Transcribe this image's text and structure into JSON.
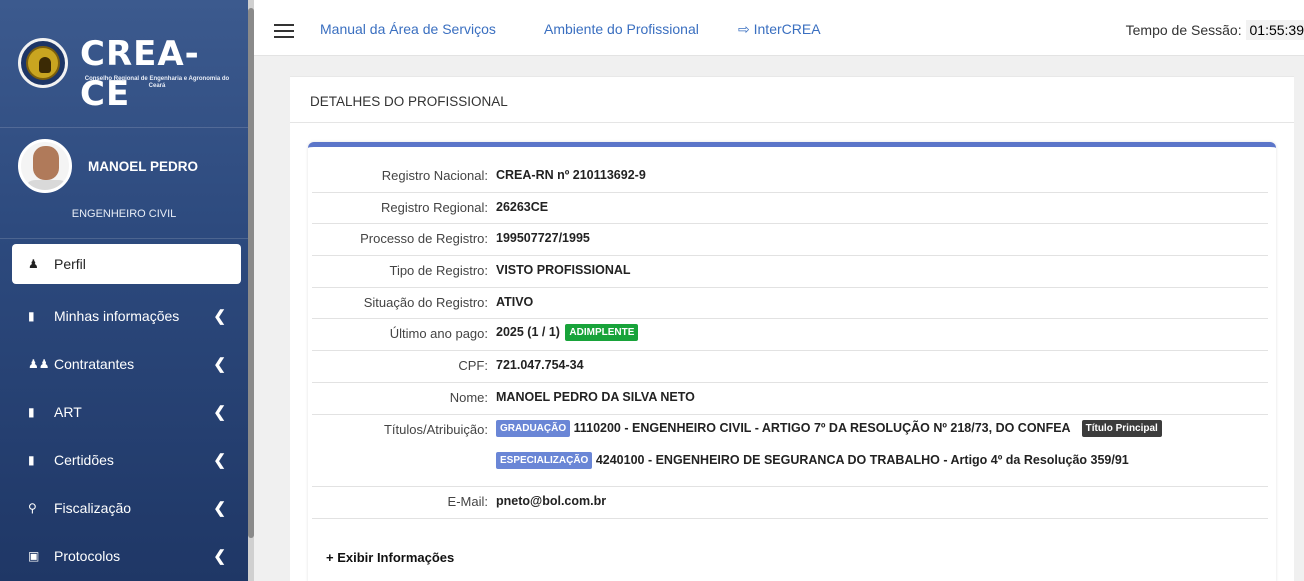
{
  "brand": {
    "name": "CREA-CE",
    "subtitle": "Conselho Regional de Engenharia e Agronomia do Ceará"
  },
  "profile": {
    "name": "MANOEL PEDRO",
    "title": "ENGENHEIRO CIVIL"
  },
  "sidebar": {
    "items": [
      {
        "label": "Perfil",
        "icon": "person-icon"
      },
      {
        "label": "Minhas informações",
        "icon": "clipboard-icon"
      },
      {
        "label": "Contratantes",
        "icon": "users-icon"
      },
      {
        "label": "ART",
        "icon": "file-icon"
      },
      {
        "label": "Certidões",
        "icon": "document-icon"
      },
      {
        "label": "Fiscalização",
        "icon": "search-icon"
      },
      {
        "label": "Protocolos",
        "icon": "inbox-icon"
      }
    ]
  },
  "topbar": {
    "link1": "Manual da Área de Serviços",
    "link2": "Ambiente do Profissional",
    "link3": "InterCREA",
    "session_label": "Tempo de Sessão:",
    "session_time": "01:55:39"
  },
  "card": {
    "header": "DETALHES DO PROFISSIONAL"
  },
  "details": {
    "registro_nacional_label": "Registro Nacional:",
    "registro_nacional": "CREA-RN nº 210113692-9",
    "registro_regional_label": "Registro Regional:",
    "registro_regional": "26263CE",
    "processo_label": "Processo de Registro:",
    "processo": "199507727/1995",
    "tipo_label": "Tipo de Registro:",
    "tipo": "VISTO PROFISSIONAL",
    "situacao_label": "Situação do Registro:",
    "situacao": "ATIVO",
    "ultimo_ano_label": "Último ano pago:",
    "ultimo_ano": "2025 (1 / 1)",
    "adimplente": "ADIMPLENTE",
    "cpf_label": "CPF:",
    "cpf": "721.047.754-34",
    "nome_label": "Nome:",
    "nome": "MANOEL PEDRO DA SILVA NETO",
    "titulos_label": "Títulos/Atribuição:",
    "titulo1_badge": "GRADUAÇÃO",
    "titulo1": "1110200 - ENGENHEIRO CIVIL - ARTIGO 7º DA RESOLUÇÃO Nº 218/73, DO CONFEA",
    "titulo1_tag": "Título Principal",
    "titulo2_badge": "ESPECIALIZAÇÃO",
    "titulo2": "4240100 - ENGENHEIRO DE SEGURANCA DO TRABALHO - Artigo 4º da Resolução 359/91",
    "email_label": "E-Mail:",
    "email": "pneto@bol.com.br"
  },
  "more_link": "+ Exibir Informações",
  "colors": {
    "accent": "#5b75c9",
    "link": "#3a6fc0",
    "sidebar": "#2d4a7e",
    "success": "#18a33a"
  }
}
